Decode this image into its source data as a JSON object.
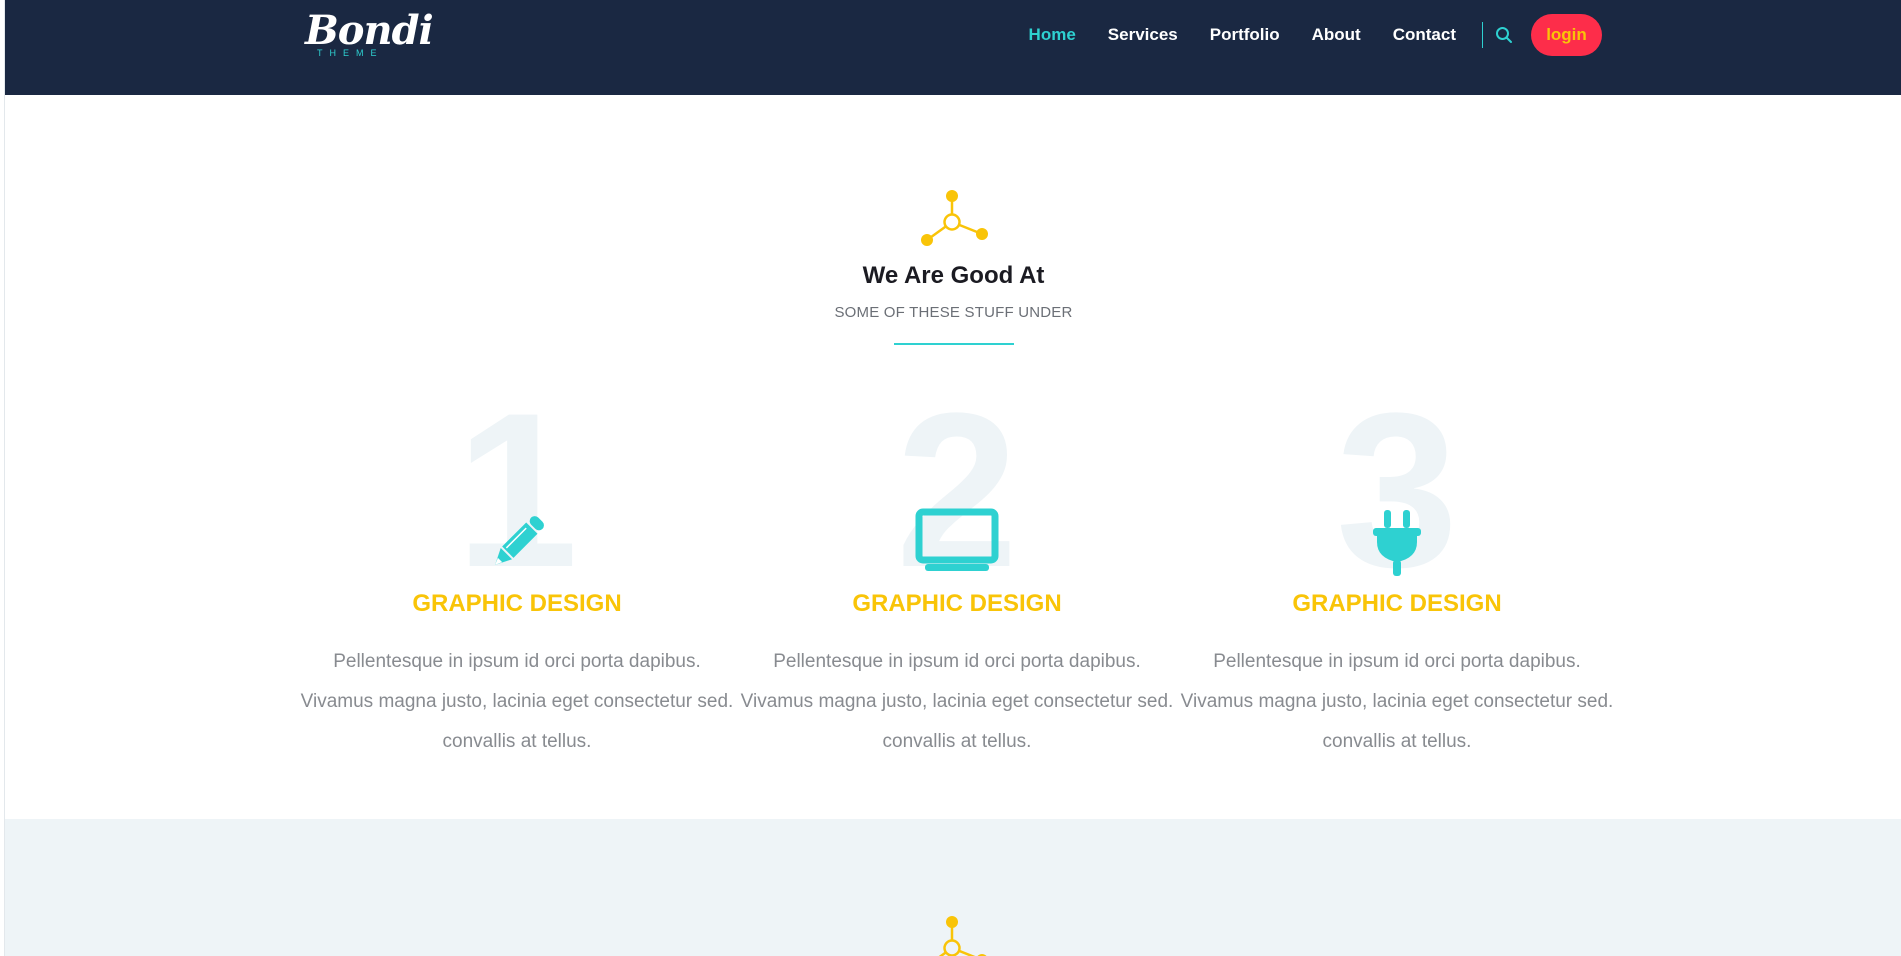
{
  "logo": {
    "text": "Bondi",
    "sub": "THEME"
  },
  "nav": {
    "items": [
      {
        "label": "Home",
        "active": true
      },
      {
        "label": "Services",
        "active": false
      },
      {
        "label": "Portfolio",
        "active": false
      },
      {
        "label": "About",
        "active": false
      },
      {
        "label": "Contact",
        "active": false
      }
    ],
    "search_icon": "search-icon",
    "login_label": "login"
  },
  "section": {
    "icon": "network-icon",
    "title": "We Are Good At",
    "subtitle": "SOME OF THESE STUFF UNDER"
  },
  "features": [
    {
      "number": "1",
      "icon": "pencil-icon",
      "title": "GRAPHIC DESIGN",
      "text": "Pellentesque in ipsum id orci porta dapibus. Vivamus magna justo, lacinia eget consectetur sed. convallis at tellus."
    },
    {
      "number": "2",
      "icon": "monitor-icon",
      "title": "GRAPHIC DESIGN",
      "text": "Pellentesque in ipsum id orci porta dapibus. Vivamus magna justo, lacinia eget consectetur sed. convallis at tellus."
    },
    {
      "number": "3",
      "icon": "plug-icon",
      "title": "GRAPHIC DESIGN",
      "text": "Pellentesque in ipsum id orci porta dapibus. Vivamus magna justo, lacinia eget consectetur sed. convallis at tellus."
    }
  ],
  "colors": {
    "header_bg": "#1a2842",
    "accent": "#2ed1d1",
    "yellow": "#f9c408",
    "login_bg": "#fd2d4a",
    "band_bg": "#eef4f7"
  }
}
